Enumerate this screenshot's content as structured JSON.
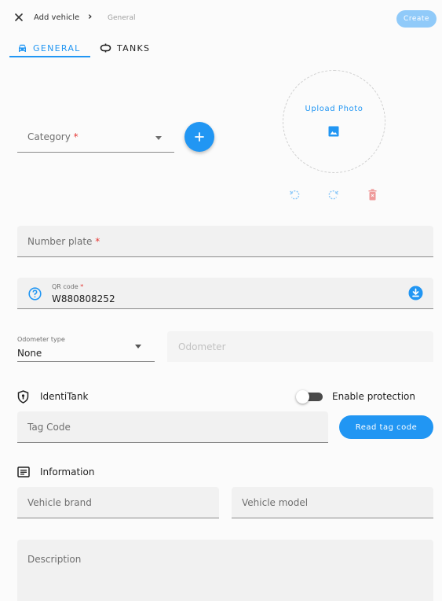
{
  "topbar": {
    "title": "Add vehicle",
    "separator": "›",
    "current": "General",
    "create_label": "Create"
  },
  "tabs": [
    {
      "label": "GENERAL",
      "icon": "car-icon",
      "active": true
    },
    {
      "label": "TANKS",
      "icon": "tanks-icon",
      "active": false
    }
  ],
  "photo": {
    "upload_label": "Upload Photo",
    "icons": [
      "image-icon",
      "rotate-left-icon",
      "rotate-right-icon",
      "delete-icon"
    ]
  },
  "category": {
    "placeholder": "Category",
    "required_mark": "*",
    "add_icon": "plus-icon"
  },
  "number_plate": {
    "placeholder": "Number plate",
    "required_mark": "*"
  },
  "qr_code": {
    "label": "QR code",
    "required_mark": "*",
    "value": "W880808252",
    "help_icon": "help-circle-icon",
    "download_icon": "download-circle-icon"
  },
  "odometer": {
    "type_label": "Odometer type",
    "type_value": "None",
    "placeholder": "Odometer"
  },
  "identitank": {
    "title": "IdentiTank",
    "icon": "shield-icon",
    "toggle_label": "Enable protection",
    "toggle_on": false,
    "tag_placeholder": "Tag Code",
    "read_button": "Read tag code"
  },
  "information": {
    "title": "Information",
    "icon": "info-list-icon",
    "brand_placeholder": "Vehicle brand",
    "model_placeholder": "Vehicle model",
    "description_placeholder": "Description"
  },
  "colors": {
    "accent": "#2196f3",
    "accent_light": "#90caf9",
    "delete": "#ef9a9a"
  }
}
